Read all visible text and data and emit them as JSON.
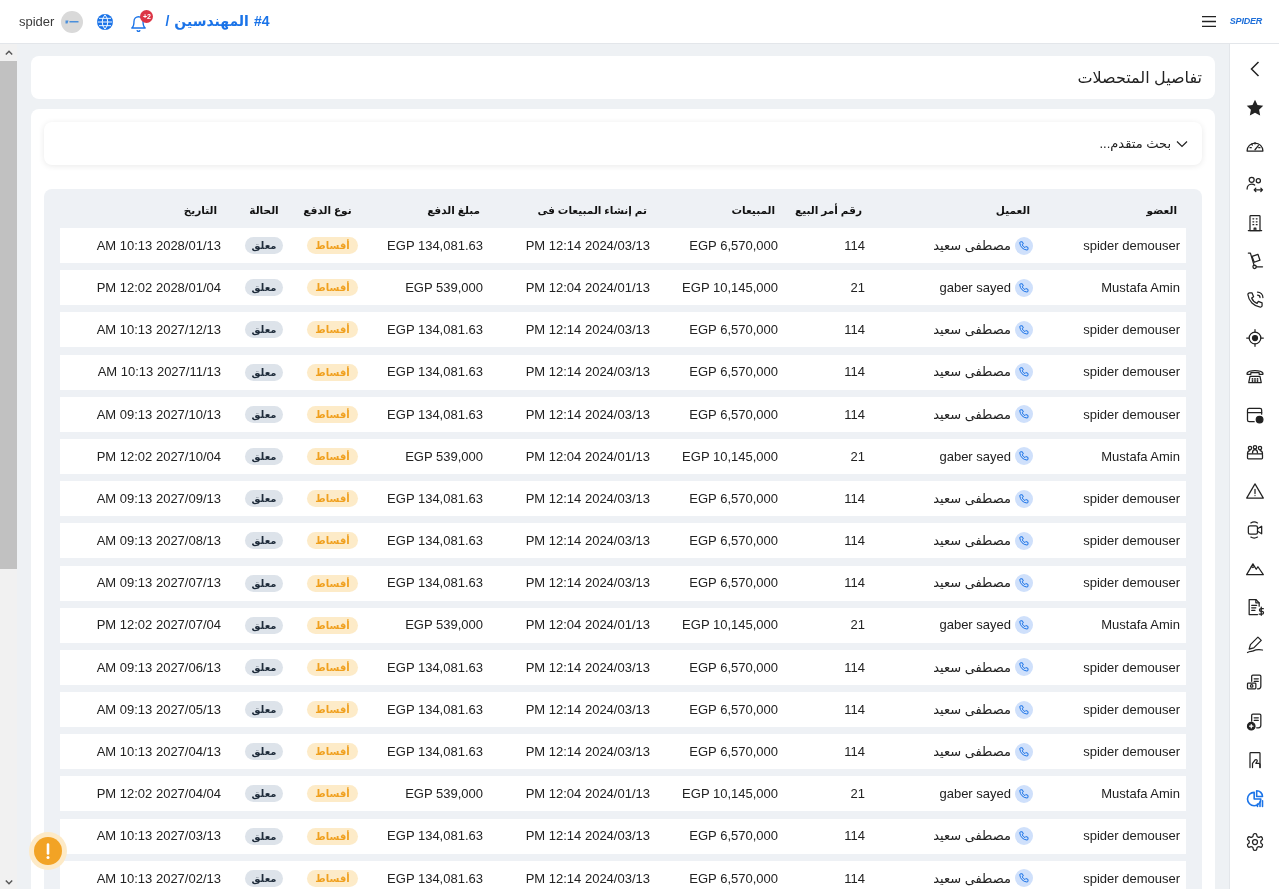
{
  "top_bar": {
    "user_name": "spider",
    "notification_count": "+2",
    "breadcrumb": {
      "separator": "/",
      "title": "المهندسين",
      "number": "#4"
    },
    "logo": "SPIDER"
  },
  "sidebar": {
    "items": [
      {
        "selected": false
      },
      {
        "selected": false
      },
      {
        "selected": false
      },
      {
        "selected": false
      },
      {
        "selected": false
      },
      {
        "selected": false
      },
      {
        "selected": false
      },
      {
        "selected": false
      },
      {
        "selected": false
      },
      {
        "selected": false
      },
      {
        "selected": false
      },
      {
        "selected": false
      },
      {
        "selected": false
      },
      {
        "selected": false
      },
      {
        "selected": false
      },
      {
        "selected": false
      },
      {
        "selected": false
      },
      {
        "selected": false
      },
      {
        "selected": true
      },
      {
        "selected": false
      }
    ]
  },
  "page_title": "تفاصيل المتحصلات",
  "advanced_search": {
    "label": "بحث متقدم...",
    "expanded": false
  },
  "table": {
    "columns": [
      "العضو",
      "العميل",
      "رقم أمر البيع",
      "المبيعات",
      "تم إنشاء المبيعات فى",
      "مبلغ الدفع",
      "نوع الدفع",
      "الحالة",
      "التاريخ"
    ],
    "rows": [
      {
        "member": "spider demouser",
        "client": "مصطفى سعيد",
        "order_number": "114",
        "sales": "EGP 6,570,000",
        "created_at": "PM 12:14 2024/03/13",
        "payment_amount": "EGP 134,081.63",
        "payment_type": "أقساط",
        "status": "معلق",
        "date": "AM 10:13 2028/01/13"
      },
      {
        "member": "Mustafa Amin",
        "client": "gaber sayed",
        "order_number": "21",
        "sales": "EGP 10,145,000",
        "created_at": "PM 12:04 2024/01/13",
        "payment_amount": "EGP 539,000",
        "payment_type": "أقساط",
        "status": "معلق",
        "date": "PM 12:02 2028/01/04"
      },
      {
        "member": "spider demouser",
        "client": "مصطفى سعيد",
        "order_number": "114",
        "sales": "EGP 6,570,000",
        "created_at": "PM 12:14 2024/03/13",
        "payment_amount": "EGP 134,081.63",
        "payment_type": "أقساط",
        "status": "معلق",
        "date": "AM 10:13 2027/12/13"
      },
      {
        "member": "spider demouser",
        "client": "مصطفى سعيد",
        "order_number": "114",
        "sales": "EGP 6,570,000",
        "created_at": "PM 12:14 2024/03/13",
        "payment_amount": "EGP 134,081.63",
        "payment_type": "أقساط",
        "status": "معلق",
        "date": "AM 10:13 2027/11/13"
      },
      {
        "member": "spider demouser",
        "client": "مصطفى سعيد",
        "order_number": "114",
        "sales": "EGP 6,570,000",
        "created_at": "PM 12:14 2024/03/13",
        "payment_amount": "EGP 134,081.63",
        "payment_type": "أقساط",
        "status": "معلق",
        "date": "AM 09:13 2027/10/13"
      },
      {
        "member": "Mustafa Amin",
        "client": "gaber sayed",
        "order_number": "21",
        "sales": "EGP 10,145,000",
        "created_at": "PM 12:04 2024/01/13",
        "payment_amount": "EGP 539,000",
        "payment_type": "أقساط",
        "status": "معلق",
        "date": "PM 12:02 2027/10/04"
      },
      {
        "member": "spider demouser",
        "client": "مصطفى سعيد",
        "order_number": "114",
        "sales": "EGP 6,570,000",
        "created_at": "PM 12:14 2024/03/13",
        "payment_amount": "EGP 134,081.63",
        "payment_type": "أقساط",
        "status": "معلق",
        "date": "AM 09:13 2027/09/13"
      },
      {
        "member": "spider demouser",
        "client": "مصطفى سعيد",
        "order_number": "114",
        "sales": "EGP 6,570,000",
        "created_at": "PM 12:14 2024/03/13",
        "payment_amount": "EGP 134,081.63",
        "payment_type": "أقساط",
        "status": "معلق",
        "date": "AM 09:13 2027/08/13"
      },
      {
        "member": "spider demouser",
        "client": "مصطفى سعيد",
        "order_number": "114",
        "sales": "EGP 6,570,000",
        "created_at": "PM 12:14 2024/03/13",
        "payment_amount": "EGP 134,081.63",
        "payment_type": "أقساط",
        "status": "معلق",
        "date": "AM 09:13 2027/07/13"
      },
      {
        "member": "Mustafa Amin",
        "client": "gaber sayed",
        "order_number": "21",
        "sales": "EGP 10,145,000",
        "created_at": "PM 12:04 2024/01/13",
        "payment_amount": "EGP 539,000",
        "payment_type": "أقساط",
        "status": "معلق",
        "date": "PM 12:02 2027/07/04"
      },
      {
        "member": "spider demouser",
        "client": "مصطفى سعيد",
        "order_number": "114",
        "sales": "EGP 6,570,000",
        "created_at": "PM 12:14 2024/03/13",
        "payment_amount": "EGP 134,081.63",
        "payment_type": "أقساط",
        "status": "معلق",
        "date": "AM 09:13 2027/06/13"
      },
      {
        "member": "spider demouser",
        "client": "مصطفى سعيد",
        "order_number": "114",
        "sales": "EGP 6,570,000",
        "created_at": "PM 12:14 2024/03/13",
        "payment_amount": "EGP 134,081.63",
        "payment_type": "أقساط",
        "status": "معلق",
        "date": "AM 09:13 2027/05/13"
      },
      {
        "member": "spider demouser",
        "client": "مصطفى سعيد",
        "order_number": "114",
        "sales": "EGP 6,570,000",
        "created_at": "PM 12:14 2024/03/13",
        "payment_amount": "EGP 134,081.63",
        "payment_type": "أقساط",
        "status": "معلق",
        "date": "AM 10:13 2027/04/13"
      },
      {
        "member": "Mustafa Amin",
        "client": "gaber sayed",
        "order_number": "21",
        "sales": "EGP 10,145,000",
        "created_at": "PM 12:04 2024/01/13",
        "payment_amount": "EGP 539,000",
        "payment_type": "أقساط",
        "status": "معلق",
        "date": "PM 12:02 2027/04/04"
      },
      {
        "member": "spider demouser",
        "client": "مصطفى سعيد",
        "order_number": "114",
        "sales": "EGP 6,570,000",
        "created_at": "PM 12:14 2024/03/13",
        "payment_amount": "EGP 134,081.63",
        "payment_type": "أقساط",
        "status": "معلق",
        "date": "AM 10:13 2027/03/13"
      },
      {
        "member": "spider demouser",
        "client": "مصطفى سعيد",
        "order_number": "114",
        "sales": "EGP 6,570,000",
        "created_at": "PM 12:14 2024/03/13",
        "payment_amount": "EGP 134,081.63",
        "payment_type": "أقساط",
        "status": "معلق",
        "date": "AM 10:13 2027/02/13"
      }
    ]
  }
}
